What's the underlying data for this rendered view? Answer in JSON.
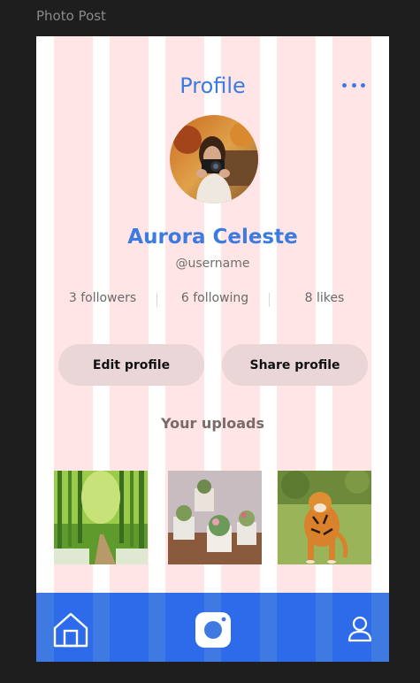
{
  "canvas": {
    "label": "Photo Post"
  },
  "header": {
    "title": "Profile",
    "more_icon": "more-horizontal-icon"
  },
  "profile": {
    "name": "Aurora Celeste",
    "handle": "@username",
    "avatar": "avatar-photo"
  },
  "stats": {
    "followers": "3 followers",
    "following": "6 following",
    "likes": "8 likes"
  },
  "actions": {
    "edit_label": "Edit profile",
    "share_label": "Share profile"
  },
  "uploads": {
    "heading": "Your uploads",
    "items": [
      {
        "subject": "bamboo-forest-path-photo"
      },
      {
        "subject": "potted-succulents-photo"
      },
      {
        "subject": "tiger-photo"
      }
    ]
  },
  "nav": {
    "items": [
      {
        "icon": "home-icon"
      },
      {
        "icon": "camera-icon"
      },
      {
        "icon": "user-icon"
      }
    ]
  },
  "colors": {
    "accent": "#3d7be0",
    "nav_background": "#3f7ae3",
    "button_fill": "#ead6d6",
    "grid_overlay": "#ffe5e5"
  }
}
